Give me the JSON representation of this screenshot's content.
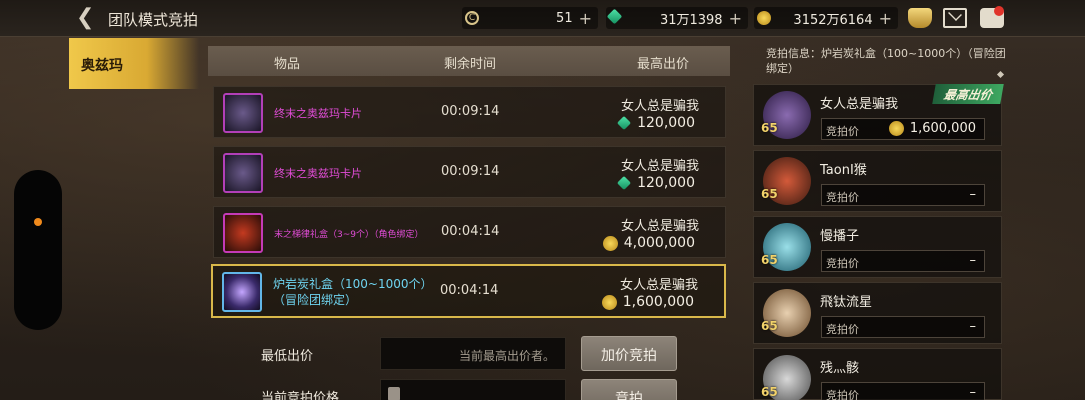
{
  "header": {
    "title": "团队模式竞拍",
    "currency_coin": "51",
    "currency_gem": "31万1398",
    "currency_gold": "3152万6164",
    "plus": "+"
  },
  "left": {
    "character_tab": "奥兹玛"
  },
  "table": {
    "columns": [
      "物品",
      "剩余时间",
      "最高出价"
    ],
    "rows": [
      {
        "name": "终末之奥兹玛卡片",
        "time": "00:09:14",
        "bidder": "女人总是骗我",
        "price": "120,000",
        "currency": "gem"
      },
      {
        "name": "终末之奥兹玛卡片",
        "time": "00:09:14",
        "bidder": "女人总是骗我",
        "price": "120,000",
        "currency": "gem"
      },
      {
        "name": "末之梯律礼盒（3~9个）（角色绑定）",
        "time": "00:04:14",
        "bidder": "女人总是骗我",
        "price": "4,000,000",
        "currency": "gold"
      },
      {
        "name": "炉岩炭礼盒（100~1000个）",
        "name_line2": "（冒险团绑定）",
        "time": "00:04:14",
        "bidder": "女人总是骗我",
        "price": "1,600,000",
        "currency": "gold"
      }
    ]
  },
  "controls": {
    "min_bid_label": "最低出价",
    "min_bid_placeholder": "当前最高出价者。",
    "raise_button": "加价竞拍",
    "current_bid_label": "当前竞拍价格",
    "bid_button": "竞拍"
  },
  "panel": {
    "info": "竞拍信息：炉岩炭礼盒（100~1000个）（冒险团绑定）",
    "highest_badge": "最高出价",
    "bid_label": "竞拍价",
    "bids": [
      {
        "name": "女人总是骗我",
        "level": "65",
        "price": "1,600,000"
      },
      {
        "name": "TaonI猴",
        "level": "65",
        "price": "–"
      },
      {
        "name": "慢播子",
        "level": "65",
        "price": "–"
      },
      {
        "name": "飛钛流星",
        "level": "65",
        "price": "–"
      },
      {
        "name": "残灬骸",
        "level": "65",
        "price": "–"
      }
    ]
  }
}
